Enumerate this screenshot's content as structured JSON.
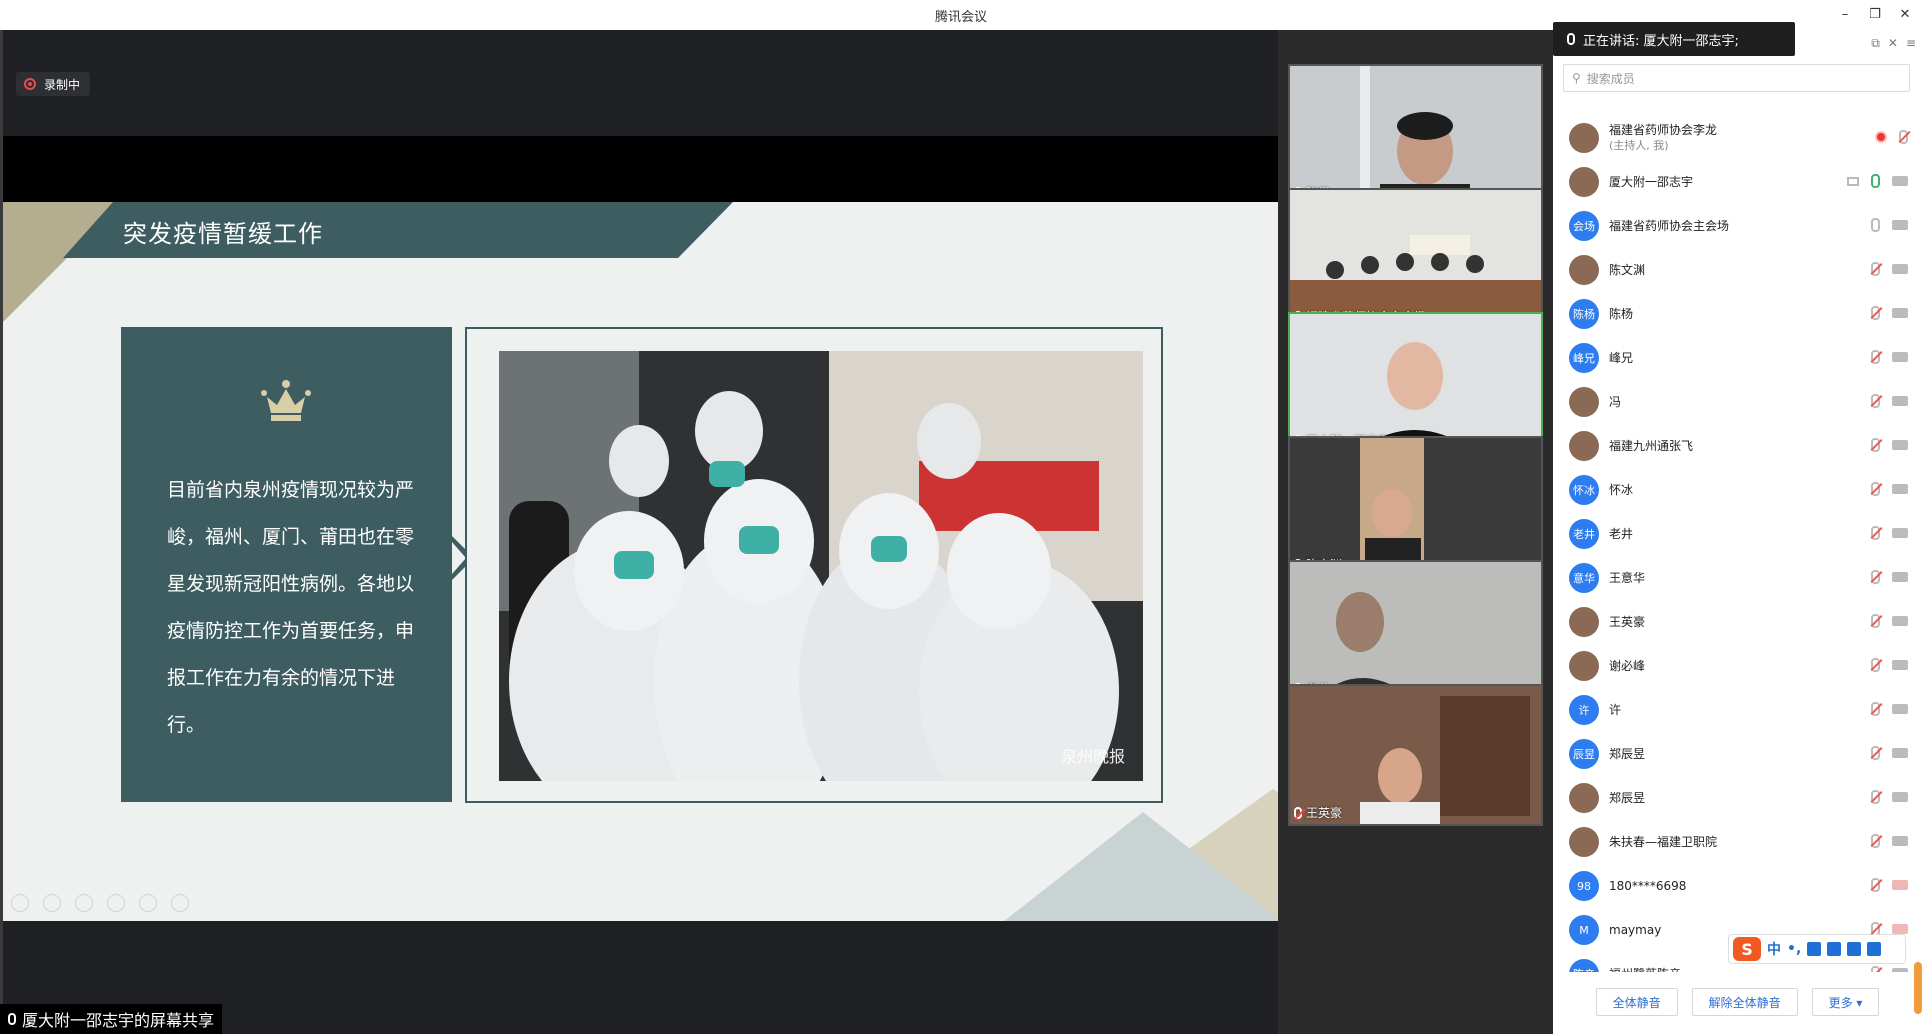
{
  "window": {
    "title": "腾讯会议",
    "min_icon": "minimize-icon",
    "max_icon": "maximize-icon",
    "close_icon": "close-icon"
  },
  "recording": {
    "label": "录制中"
  },
  "slide": {
    "title": "突发疫情暂缓工作",
    "paragraph": "目前省内泉州疫情现况较为严峻，福州、厦门、莆田也在零星发现新冠阳性病例。各地以疫情防控工作为首要任务，申报工作在力有余的情况下进行。",
    "photo_watermark": "泉州晚报"
  },
  "share_bar": {
    "label": "厦大附一邵志宇的屏幕共享"
  },
  "video_tiles": [
    {
      "name": "陈杨",
      "mic": "off"
    },
    {
      "name": "福建省药师协会主会场",
      "mic": "on"
    },
    {
      "name": "厦大附一邵志宇",
      "mic": "on",
      "active": true
    },
    {
      "name": "陈文渊",
      "mic": "off"
    },
    {
      "name": "老井",
      "mic": "off"
    },
    {
      "name": "王英豪",
      "mic": "off"
    }
  ],
  "panel": {
    "speaking_label": "正在讲话: 厦大附一邵志宇;",
    "search_placeholder": "搜索成员",
    "members": [
      {
        "avatar": "",
        "name": "福建省药师协会李龙",
        "sub": "(主持人, 我)",
        "status": "rec"
      },
      {
        "avatar": "",
        "name": "厦大附一邵志宇",
        "sub": "",
        "status": "speaking"
      },
      {
        "avatar": "会场",
        "name": "福建省药师协会主会场",
        "sub": "",
        "status": "mic-on"
      },
      {
        "avatar": "",
        "name": "陈文渊",
        "sub": "",
        "status": "muted"
      },
      {
        "avatar": "陈杨",
        "name": "陈杨",
        "sub": "",
        "status": "muted"
      },
      {
        "avatar": "峰兄",
        "name": "峰兄",
        "sub": "",
        "status": "muted"
      },
      {
        "avatar": "",
        "name": "冯",
        "sub": "",
        "status": "muted"
      },
      {
        "avatar": "",
        "name": "福建九州通张飞",
        "sub": "",
        "status": "muted"
      },
      {
        "avatar": "怀冰",
        "name": "怀冰",
        "sub": "",
        "status": "muted"
      },
      {
        "avatar": "老井",
        "name": "老井",
        "sub": "",
        "status": "muted"
      },
      {
        "avatar": "意华",
        "name": "王意华",
        "sub": "",
        "status": "muted"
      },
      {
        "avatar": "",
        "name": "王英豪",
        "sub": "",
        "status": "muted"
      },
      {
        "avatar": "",
        "name": "谢必峰",
        "sub": "",
        "status": "muted"
      },
      {
        "avatar": "许",
        "name": "许",
        "sub": "",
        "status": "muted"
      },
      {
        "avatar": "辰昱",
        "name": "郑辰昱",
        "sub": "",
        "status": "muted"
      },
      {
        "avatar": "",
        "name": "郑辰昱",
        "sub": "",
        "status": "muted"
      },
      {
        "avatar": "",
        "name": "朱扶春—福建卫职院",
        "sub": "",
        "status": "muted"
      },
      {
        "avatar": "98",
        "name": "180****6698",
        "sub": "",
        "status": "muted-nocam"
      },
      {
        "avatar": "M",
        "name": "maymay",
        "sub": "",
        "status": "muted-nocam"
      },
      {
        "avatar": "陈亲",
        "name": "福州鹭薇陈亲",
        "sub": "",
        "status": "muted"
      }
    ],
    "buttons": {
      "mute_all": "全体静音",
      "unmute_all": "解除全体静音",
      "more": "更多 ▾"
    }
  },
  "ime": {
    "mode": "中",
    "punct": "•,"
  }
}
